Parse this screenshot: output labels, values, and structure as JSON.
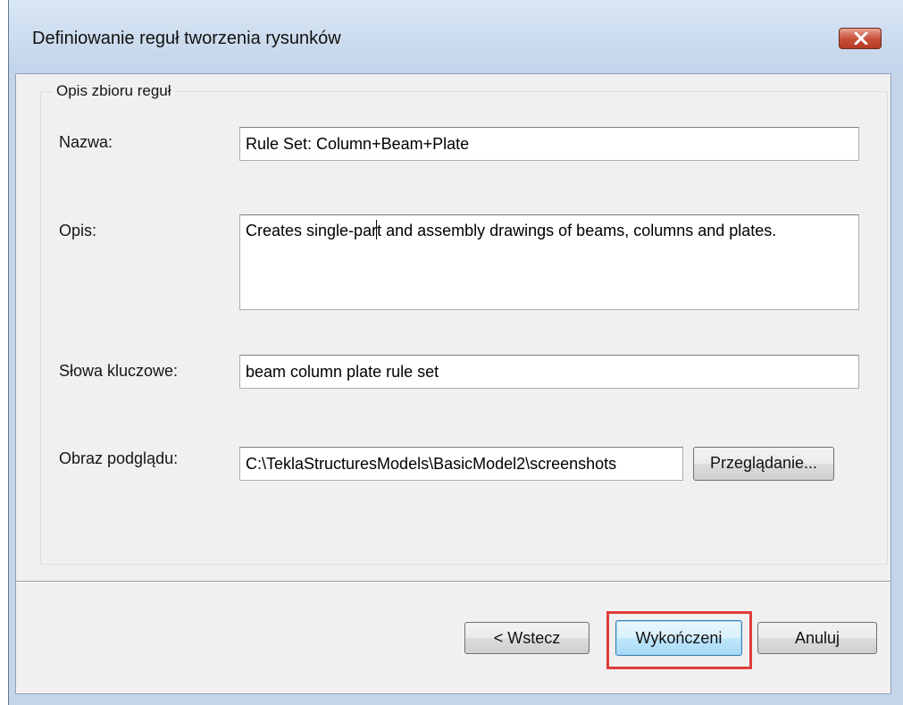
{
  "window": {
    "title": "Definiowanie reguł tworzenia rysunków",
    "close_icon": "close-icon"
  },
  "group": {
    "legend": "Opis zbioru reguł"
  },
  "fields": {
    "name_label": "Nazwa:",
    "name_value": "Rule Set: Column+Beam+Plate",
    "description_label": "Opis:",
    "description_value": "Creates single-part and assembly drawings of beams, columns and plates.",
    "keywords_label": "Słowa kluczowe:",
    "keywords_value": "beam column plate rule set",
    "preview_label": "Obraz podglądu:",
    "preview_value": "C:\\TeklaStructuresModels\\BasicModel2\\screenshots",
    "browse_button": "Przeglądanie..."
  },
  "buttons": {
    "back": "< Wstecz",
    "finish": "Wykończeni",
    "cancel": "Anuluj"
  },
  "colors": {
    "highlight": "#e03c3c",
    "title_bar": "#c5d5e9"
  }
}
